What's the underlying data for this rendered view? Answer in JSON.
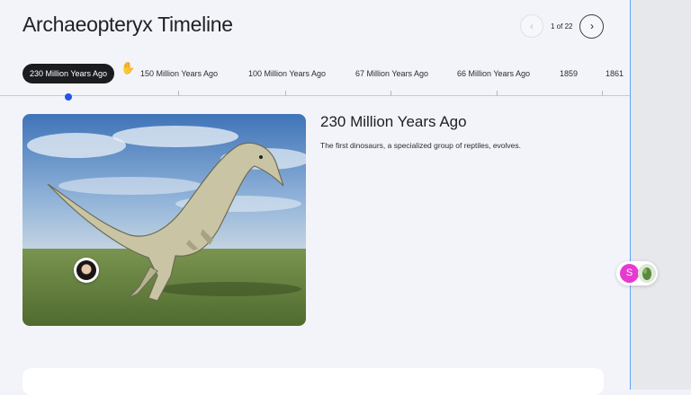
{
  "page": {
    "title": "Archaeopteryx Timeline"
  },
  "pager": {
    "count": "1 of 22",
    "prev_icon": "chevron-left-icon",
    "next_icon": "chevron-right-icon"
  },
  "timeline": {
    "items": [
      {
        "label": "230 Million Years Ago"
      },
      {
        "label": "150 Million Years Ago"
      },
      {
        "label": "100 Million Years Ago"
      },
      {
        "label": "67 Million Years Ago"
      },
      {
        "label": "66 Million Years Ago"
      },
      {
        "label": "1859"
      },
      {
        "label": "1861"
      }
    ],
    "active_index": 0
  },
  "detail": {
    "title": "230 Million Years Ago",
    "description": "The first dinosaurs, a specialized group of reptiles, evolves."
  },
  "presence": {
    "initial": "S",
    "initial_color": "#e63bd1"
  },
  "colors": {
    "accent": "#2255e6",
    "active_pill": "#1b1c20",
    "panel_divider": "#5aa6f5"
  }
}
